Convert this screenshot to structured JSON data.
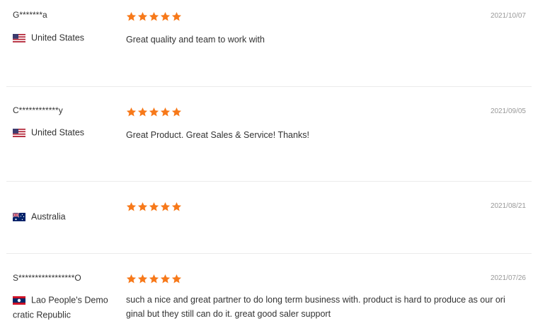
{
  "colors": {
    "star": "#f7791a",
    "divider": "#ebebeb",
    "date_text": "#999999",
    "body_text": "#333333"
  },
  "reviews": [
    {
      "user": "G*******a",
      "country": "United States",
      "flag_icon": "us-flag-icon",
      "rating": 5,
      "date": "2021/10/07",
      "text": "Great quality and team to work with"
    },
    {
      "user": "C************y",
      "country": "United States",
      "flag_icon": "us-flag-icon",
      "rating": 5,
      "date": "2021/09/05",
      "text": "Great Product. Great Sales & Service! Thanks!"
    },
    {
      "user": "",
      "country": "Australia",
      "flag_icon": "au-flag-icon",
      "rating": 5,
      "date": "2021/08/21",
      "text": ""
    },
    {
      "user": "S*****************O",
      "country": "Lao People's Demo cratic Republic",
      "flag_icon": "la-flag-icon",
      "rating": 5,
      "date": "2021/07/26",
      "text": "such a nice and great partner to do long term business with. product is hard to produce as our ori ginal but they still can do it. great good saler support"
    }
  ]
}
